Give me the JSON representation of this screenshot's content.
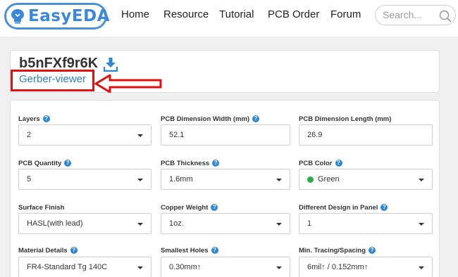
{
  "header": {
    "logo_text": "EasyEDA",
    "nav": [
      "Home",
      "Resource",
      "Tutorial",
      "PCB Order",
      "Forum"
    ],
    "search_placeholder": "Search..."
  },
  "title": {
    "pcb_id": "b5nFXf9r6K",
    "gerber_link": "Gerber-viewer"
  },
  "form": {
    "layers": {
      "label": "Layers",
      "value": "2"
    },
    "width": {
      "label": "PCB Dimension Width (mm)",
      "value": "52.1"
    },
    "length": {
      "label": "PCB Dimension Length (mm)",
      "value": "26.9"
    },
    "quantity": {
      "label": "PCB Quantity",
      "value": "5"
    },
    "thickness": {
      "label": "PCB Thickness",
      "value": "1.6mm"
    },
    "color": {
      "label": "PCB Color",
      "value": "Green",
      "swatch": "#2eaa4a"
    },
    "finish": {
      "label": "Surface Finish",
      "value": "HASL(with lead)"
    },
    "copper": {
      "label": "Copper Weight",
      "value": "1oz."
    },
    "panel": {
      "label": "Different Design in Panel",
      "value": "1"
    },
    "material": {
      "label": "Material Details",
      "value": "FR4-Standard Tg 140C"
    },
    "holes": {
      "label": "Smallest Holes",
      "value": "0.30mm↑"
    },
    "tracing": {
      "label": "Min. Tracing/Spacing",
      "value": "6mil↑ / 0.152mm↑"
    }
  },
  "colors": {
    "accent": "#2e86d6",
    "annotation": "#e01010"
  }
}
